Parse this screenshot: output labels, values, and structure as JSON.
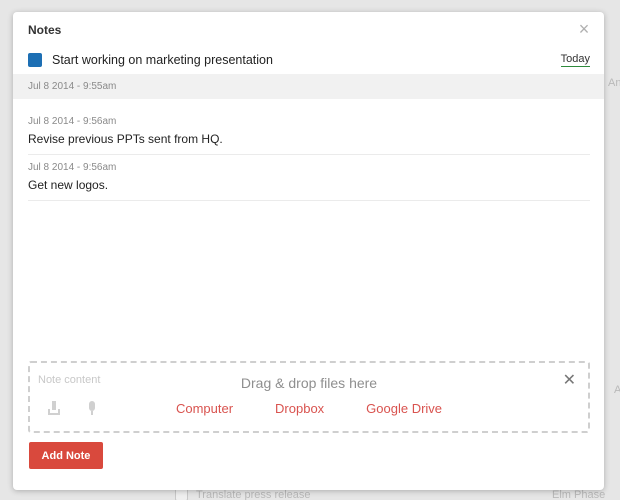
{
  "background": {
    "peek_right_top": "An",
    "peek_right_mid": "A",
    "row_label": "Translate press release",
    "row_right": "Elm Phase An"
  },
  "modal": {
    "title": "Notes",
    "close_icon": "close-icon",
    "task": {
      "name": "Start working on marketing presentation",
      "color": "#1d6fb4",
      "due": "Today"
    },
    "header_timestamp": "Jul 8 2014 - 9:55am",
    "notes": [
      {
        "timestamp": "Jul 8 2014 - 9:56am",
        "text": "Revise previous PPTs sent from HQ."
      },
      {
        "timestamp": "Jul 8 2014 - 9:56am",
        "text": "Get new logos."
      }
    ],
    "composer": {
      "placeholder": "Note content",
      "dropzone_text": "Drag & drop files here",
      "sources": [
        "Computer",
        "Dropbox",
        "Google Drive"
      ]
    },
    "add_button_label": "Add Note"
  }
}
